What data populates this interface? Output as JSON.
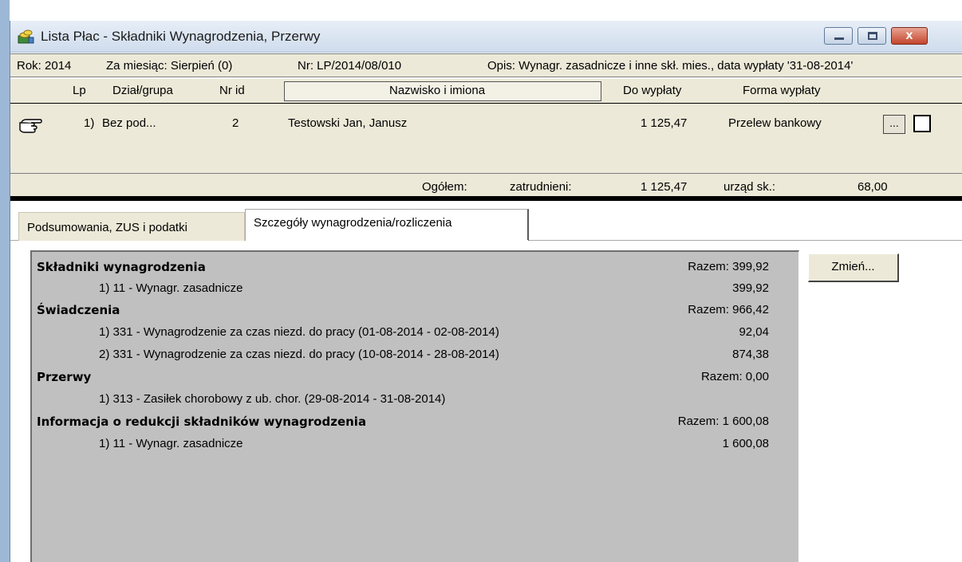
{
  "window": {
    "title": "Lista Płac - Składniki Wynagrodzenia, Przerwy",
    "close_label": "x"
  },
  "info": {
    "rok": "Rok: 2014",
    "miesiac": "Za miesiąc: Sierpień (0)",
    "nr": "Nr: LP/2014/08/010",
    "opis": "Opis: Wynagr. zasadnicze i inne skł. mies., data wypłaty '31-08-2014'"
  },
  "grid": {
    "headers": {
      "lp": "Lp",
      "dzial": "Dział/grupa",
      "nrid": "Nr id",
      "nazwisko": "Nazwisko i imiona",
      "dowyplaty": "Do wypłaty",
      "forma": "Forma wypłaty"
    },
    "row": {
      "lp": "1)",
      "dzial": "Bez pod...",
      "nrid": "2",
      "nazwisko": "Testowski Jan, Janusz",
      "dowyplaty": "1 125,47",
      "forma": "Przelew bankowy",
      "dots": "..."
    },
    "totals": {
      "ogolem": "Ogółem:",
      "zatrudnieni": "zatrudnieni:",
      "zatrudnieni_value": "1 125,47",
      "urzad": "urząd sk.:",
      "urzad_value": "68,00"
    }
  },
  "tabs": {
    "summary": "Podsumowania, ZUS i podatki",
    "details": "Szczegóły wynagrodzenia/rozliczenia"
  },
  "details": {
    "sections": [
      {
        "label": "Składniki wynagrodzenia",
        "total": "Razem: 399,92"
      },
      {
        "label": "Świadczenia",
        "total": "Razem: 966,42"
      },
      {
        "label": "Przerwy",
        "total": "Razem: 0,00"
      },
      {
        "label": "Informacja o redukcji składników wynagrodzenia",
        "total": "Razem: 1 600,08"
      }
    ],
    "items": [
      {
        "text": "1)  11 - Wynagr. zasadnicze",
        "amount": "399,92"
      },
      {
        "text": "1)  331 - Wynagrodzenie za czas niezd. do pracy (01-08-2014 - 02-08-2014)",
        "amount": "92,04"
      },
      {
        "text": "2)  331 - Wynagrodzenie za czas niezd. do pracy (10-08-2014 - 28-08-2014)",
        "amount": "874,38"
      },
      {
        "text": "1)  313 - Zasiłek chorobowy z ub. chor. (29-08-2014 - 31-08-2014)",
        "amount": ""
      },
      {
        "text": "1)  11 - Wynagr. zasadnicze",
        "amount": "1 600,08"
      }
    ],
    "change_button": "Zmień..."
  },
  "icons": {
    "app": "payroll-app-icon",
    "pointer": "hand-pointer-icon"
  }
}
